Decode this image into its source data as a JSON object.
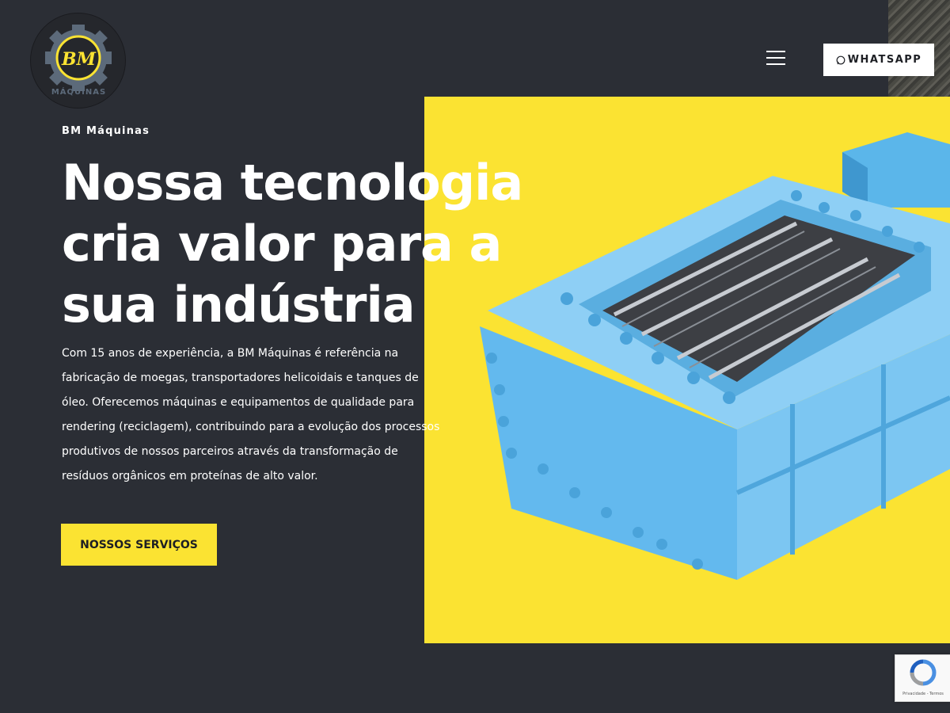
{
  "brand": {
    "logo_initials": "BM",
    "logo_text": "MÁQUINAS",
    "accent_color": "#fbe332",
    "background_color": "#2b2e35"
  },
  "header": {
    "menu_icon": "hamburger-menu-icon",
    "whatsapp_label": "WHATSAPP",
    "whatsapp_icon": "whatsapp-icon"
  },
  "hero": {
    "eyebrow": "BM Máquinas",
    "headline_line1": "Nossa tecnologia",
    "headline_line2": "cria valor para a",
    "headline_line3": "sua indústria",
    "description": "Com 15 anos de experiência, a BM Máquinas é referência na fabricação de moegas, transportadores helicoidais e tanques de óleo. Oferecemos máquinas e equipamentos de qualidade para rendering (reciclagem), contribuindo para a evolução dos processos produtivos de nossos parceiros através da transformação de resíduos orgânicos em proteínas de alto valor.",
    "cta_label": "NOSSOS SERVIÇOS"
  },
  "recaptcha": {
    "footer_text": "Privacidade - Termos",
    "icon": "recaptcha-icon"
  }
}
